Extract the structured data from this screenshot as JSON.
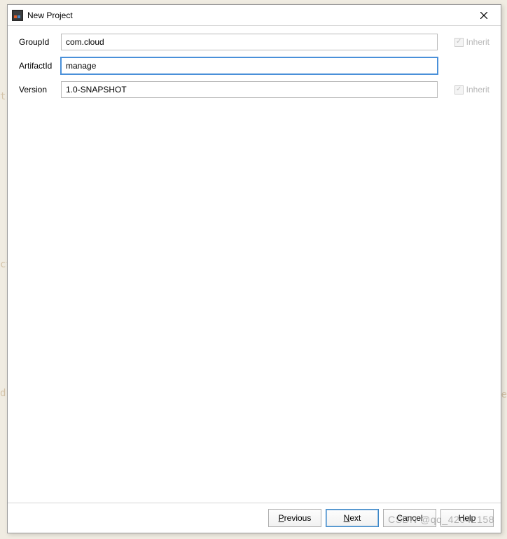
{
  "title": "New Project",
  "form": {
    "group_label": "GroupId",
    "group_value": "com.cloud",
    "artifact_label": "ArtifactId",
    "artifact_value": "manage",
    "version_label": "Version",
    "version_value": "1.0-SNAPSHOT",
    "inherit_label": "Inherit",
    "inherit_group_checked": true,
    "inherit_version_checked": true
  },
  "buttons": {
    "previous": "Previous",
    "next": "Next",
    "cancel": "Cancel",
    "help": "Help"
  },
  "watermark": "CSDN @qq_42042158"
}
